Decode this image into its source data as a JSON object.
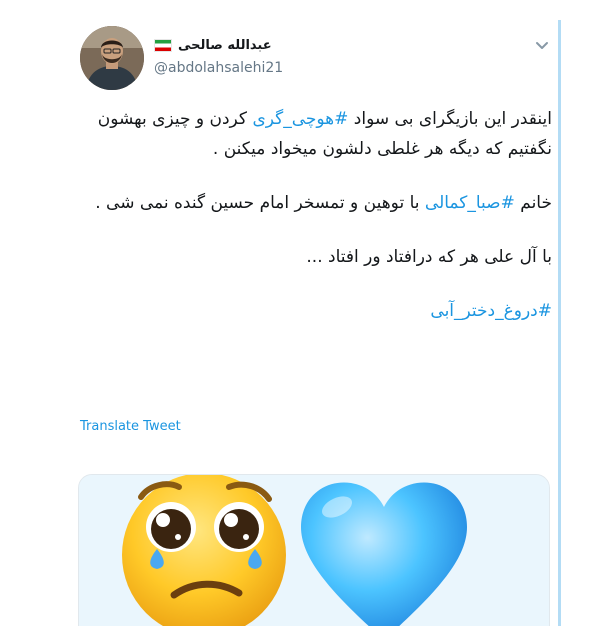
{
  "tweet": {
    "display_name": "عبدالله صالحی",
    "handle": "@abdolahsalehi21",
    "paragraphs": [
      [
        {
          "text": "اینقدر این بازیگرای بی سواد "
        },
        {
          "text": "#هوچی_گری",
          "hashtag": true
        },
        {
          "text": " کردن و چیزی بهشون نگفتیم که دیگه هر غلطی دلشون میخواد میکنن ."
        }
      ],
      [
        {
          "text": "خانم "
        },
        {
          "text": "#صبا_کمالی",
          "hashtag": true
        },
        {
          "text": " با توهین و تمسخر امام حسین گنده نمی شی ."
        }
      ],
      [
        {
          "text": "با آل علی هر که درافتاد ور افتاد ..."
        }
      ],
      [
        {
          "text": "#دروغ_دختر_آبی",
          "hashtag": true
        }
      ]
    ],
    "translate_label": "Translate Tweet"
  },
  "icons": {
    "caret": "chevron-down-icon",
    "flag": "iran-flag-icon",
    "media": [
      "pleading-face-emoji",
      "blue-heart-emoji"
    ]
  },
  "colors": {
    "accent": "#1b95e0",
    "text": "#14171a",
    "secondary": "#657786",
    "rule": "#b3dcf5"
  }
}
